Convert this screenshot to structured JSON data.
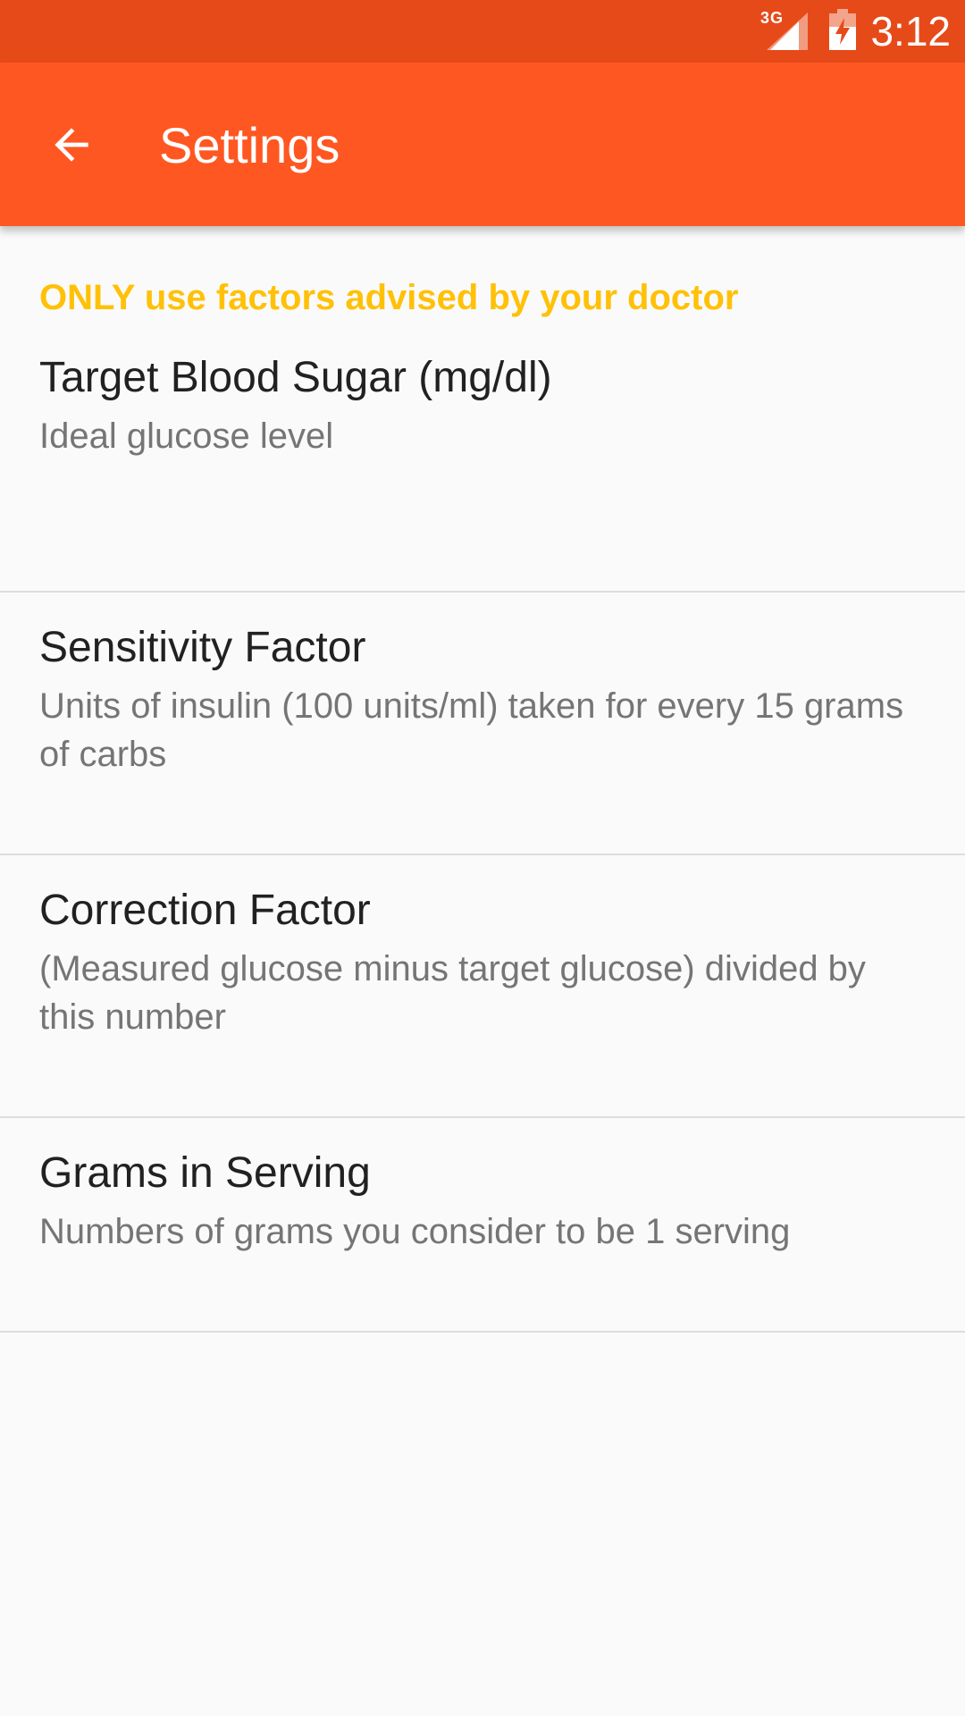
{
  "status_bar": {
    "network": "3G",
    "time": "3:12",
    "bar_color": "#E64A19"
  },
  "app_bar": {
    "title": "Settings",
    "back_icon": "arrow-left-icon",
    "color": "#FF5722"
  },
  "warning": {
    "text": "ONLY use factors advised by your doctor",
    "color": "#FFC107"
  },
  "preferences": [
    {
      "title": "Target Blood Sugar (mg/dl)",
      "summary": "Ideal glucose level"
    },
    {
      "title": "Sensitivity Factor",
      "summary": "Units of insulin (100 units/ml) taken for every 15 grams of carbs"
    },
    {
      "title": "Correction Factor",
      "summary": "(Measured glucose minus target glucose) divided by this number"
    },
    {
      "title": "Grams in Serving",
      "summary": "Numbers of grams you consider to be 1 serving"
    }
  ]
}
